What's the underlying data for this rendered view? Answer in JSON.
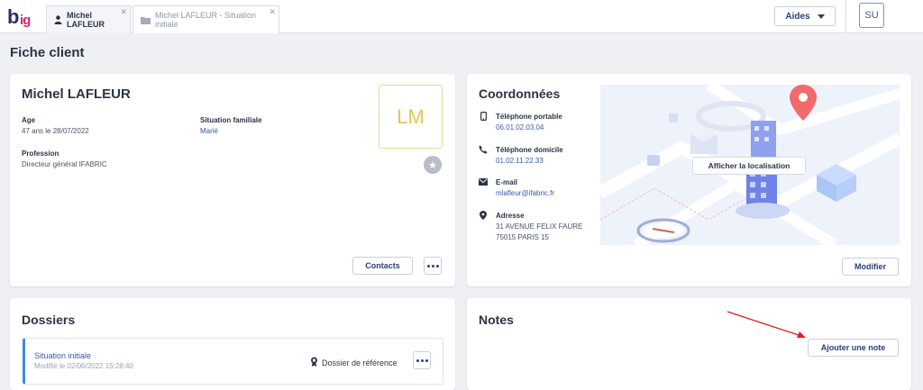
{
  "app": {
    "logo": "big"
  },
  "tabs": [
    {
      "label": "Michel LAFLEUR",
      "icon": "person-icon"
    },
    {
      "label": "Michel LAFLEUR - Situation initiale",
      "icon": "folder-icon"
    }
  ],
  "header": {
    "aides_label": "Aides",
    "user_initials": "SU"
  },
  "page": {
    "title": "Fiche client"
  },
  "client": {
    "name": "Michel LAFLEUR",
    "age_label": "Age",
    "age_value": "47 ans le 28/07/2022",
    "situation_label": "Situation familiale",
    "situation_value": "Marié",
    "profession_label": "Profession",
    "profession_value": "Directeur général IFABRIC",
    "initials": "LM",
    "contacts_button": "Contacts"
  },
  "coordonnees": {
    "title": "Coordonnées",
    "mobile_label": "Téléphone portable",
    "mobile_value": "06.01.02.03.04",
    "home_label": "Téléphone domicile",
    "home_value": "01.02.11.22.33",
    "email_label": "E-mail",
    "email_value": "mlafleur@ifabric.fr",
    "address_label": "Adresse",
    "address_line1": "31 AVENUE FELIX FAURE",
    "address_line2": "75015 PARIS 15",
    "map_button": "Afficher la localisation",
    "edit_button": "Modifier"
  },
  "dossiers": {
    "title": "Dossiers",
    "item_title": "Situation initiale",
    "item_modified": "Modifié le 02/06/2022 15:28:40",
    "item_reference": "Dossier de référence"
  },
  "notes": {
    "title": "Notes",
    "add_button": "Ajouter une note"
  },
  "colors": {
    "accent": "#2a3f78",
    "brand_pink": "#d9246b",
    "dossier_bar": "#3c8de0",
    "arrow": "#e02020"
  }
}
